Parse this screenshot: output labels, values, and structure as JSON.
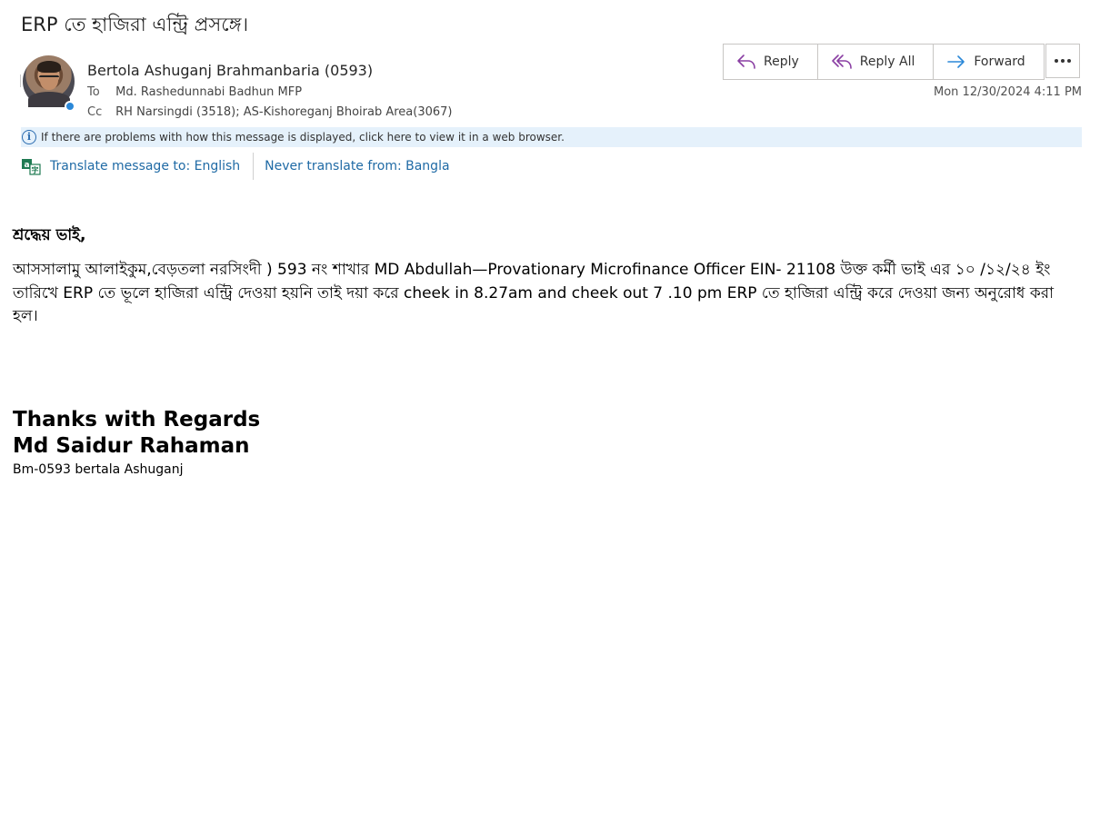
{
  "message": {
    "subject": "ERP তে হাজিরা এন্ট্রি প্রসঙ্গে।",
    "sender": "Bertola Ashuganj Brahmanbaria (0593)",
    "to_label": "To",
    "to": "Md. Rashedunnabi Badhun MFP",
    "cc_label": "Cc",
    "cc": "RH Narsingdi (3518); AS-Kishoreganj Bhoirab Area(3067)",
    "date": "Mon 12/30/2024 4:11 PM"
  },
  "actions": {
    "reply": "Reply",
    "reply_all": "Reply All",
    "forward": "Forward",
    "more_icon": "more-ellipsis-icon"
  },
  "infobar": {
    "text": "If there are problems with how this message is displayed, click here to view it in a web browser."
  },
  "translate": {
    "translate_link": "Translate message to: English",
    "never_link": "Never translate from: Bangla"
  },
  "body": {
    "greeting": "শ্রদ্ধেয় ভাই,",
    "paragraph": "আসসালামু আলাইকুম,বেড়তলা নরসিংদী ) 593 নং শাখার  MD Abdullah—Provationary Microfinance Officer EIN- 21108  উক্ত কর্মী ভাই এর ১০ /১২/২৪ ইং তারিখে ERP তে ভূলে হাজিরা এন্ট্রি দেওয়া হয়নি তাই দয়া করে  cheek in 8.27am and cheek out 7  .10 pm  ERP তে হাজিরা এন্ট্রি করে দেওয়া জন্য অনুরোধ করা হল।",
    "signature_line1": "Thanks with Regards",
    "signature_line2": "Md Saidur Rahaman",
    "signature_line3": "Bm-0593 bertala Ashuganj"
  },
  "colors": {
    "accent_purple": "#8a3fa3",
    "accent_blue": "#2b88d8",
    "link_blue": "#1f6aa5",
    "infobar_bg": "#e5f1fb"
  }
}
